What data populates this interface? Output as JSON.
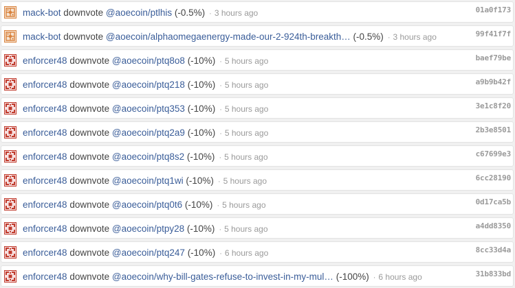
{
  "feed": {
    "rows": [
      {
        "user": "mack-bot",
        "avatar": "mack-bot-avatar-icon",
        "action": "downvote",
        "target": "@aoecoin/ptlhis",
        "pct": "(-0.5%)",
        "time": "3 hours ago",
        "hash": "01a0f173"
      },
      {
        "user": "mack-bot",
        "avatar": "mack-bot-avatar-icon",
        "action": "downvote",
        "target": "@aoecoin/alphaomegaenergy-made-our-2-924th-breakth…",
        "pct": "(-0.5%)",
        "time": "3 hours ago",
        "hash": "99f41f7f"
      },
      {
        "user": "enforcer48",
        "avatar": "enforcer48-avatar-icon",
        "action": "downvote",
        "target": "@aoecoin/ptq8o8",
        "pct": "(-10%)",
        "time": "5 hours ago",
        "hash": "baef79be"
      },
      {
        "user": "enforcer48",
        "avatar": "enforcer48-avatar-icon",
        "action": "downvote",
        "target": "@aoecoin/ptq218",
        "pct": "(-10%)",
        "time": "5 hours ago",
        "hash": "a9b9b42f"
      },
      {
        "user": "enforcer48",
        "avatar": "enforcer48-avatar-icon",
        "action": "downvote",
        "target": "@aoecoin/ptq353",
        "pct": "(-10%)",
        "time": "5 hours ago",
        "hash": "3e1c8f20"
      },
      {
        "user": "enforcer48",
        "avatar": "enforcer48-avatar-icon",
        "action": "downvote",
        "target": "@aoecoin/ptq2a9",
        "pct": "(-10%)",
        "time": "5 hours ago",
        "hash": "2b3e8501"
      },
      {
        "user": "enforcer48",
        "avatar": "enforcer48-avatar-icon",
        "action": "downvote",
        "target": "@aoecoin/ptq8s2",
        "pct": "(-10%)",
        "time": "5 hours ago",
        "hash": "c67699e3"
      },
      {
        "user": "enforcer48",
        "avatar": "enforcer48-avatar-icon",
        "action": "downvote",
        "target": "@aoecoin/ptq1wi",
        "pct": "(-10%)",
        "time": "5 hours ago",
        "hash": "6cc28190"
      },
      {
        "user": "enforcer48",
        "avatar": "enforcer48-avatar-icon",
        "action": "downvote",
        "target": "@aoecoin/ptq0t6",
        "pct": "(-10%)",
        "time": "5 hours ago",
        "hash": "0d17ca5b"
      },
      {
        "user": "enforcer48",
        "avatar": "enforcer48-avatar-icon",
        "action": "downvote",
        "target": "@aoecoin/ptpy28",
        "pct": "(-10%)",
        "time": "5 hours ago",
        "hash": "a4dd8350"
      },
      {
        "user": "enforcer48",
        "avatar": "enforcer48-avatar-icon",
        "action": "downvote",
        "target": "@aoecoin/ptq247",
        "pct": "(-10%)",
        "time": "6 hours ago",
        "hash": "8cc33d4a"
      },
      {
        "user": "enforcer48",
        "avatar": "enforcer48-avatar-icon",
        "action": "downvote",
        "target": "@aoecoin/why-bill-gates-refuse-to-invest-in-my-mul…",
        "pct": "(-100%)",
        "time": "6 hours ago",
        "hash": "31b833bd"
      }
    ],
    "separator": "·"
  },
  "colors": {
    "link": "#3a5d99",
    "text": "#444444",
    "muted": "#9a9a9a",
    "row_bg": "#ffffff",
    "page_bg": "#f0f0f0",
    "avatar_mack_bot": "#d9823c",
    "avatar_enforcer48": "#c0392b"
  }
}
